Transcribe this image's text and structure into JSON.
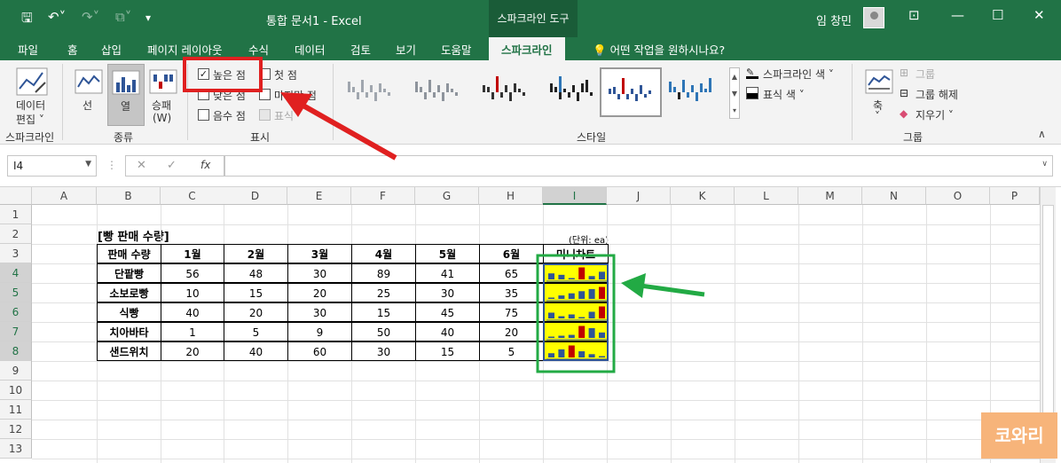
{
  "window": {
    "doc_title": "통합 문서1  -  Excel",
    "context_tab_header": "스파크라인 도구",
    "user_name": "임 창민"
  },
  "tabs": [
    "파일",
    "홈",
    "삽입",
    "페이지 레이아웃",
    "수식",
    "데이터",
    "검토",
    "보기",
    "도움말",
    "스파크라인"
  ],
  "active_tab_index": 9,
  "tell_me": "어떤 작업을 원하시나요?",
  "ribbon": {
    "sparkline_group": {
      "edit_data_line1": "데이터",
      "edit_data_line2": "편집 ˅",
      "group_label": "스파크라인"
    },
    "type_group": {
      "line": "선",
      "column": "열",
      "winloss_line1": "승패",
      "winloss_line2": "(W)",
      "group_label": "종류"
    },
    "show_group": {
      "high_point": "높은 점",
      "first_point": "첫 점",
      "low_point": "낮은 점",
      "last_point": "마지막 점",
      "negative_points": "음수 점",
      "markers": "표식",
      "group_label": "표시",
      "checked": {
        "high_point": true,
        "first_point": false,
        "low_point": false,
        "last_point": false,
        "negative_points": false,
        "markers": false
      }
    },
    "style_group": {
      "group_label": "스타일"
    },
    "color_group": {
      "sparkline_color": "스파크라인 색 ˅",
      "marker_color": "표식 색 ˅"
    },
    "group_group": {
      "axis_line1": "축",
      "axis_line2": "˅",
      "group": "그룹",
      "ungroup": "그룹 해제",
      "clear": "지우기 ˅",
      "group_label": "그룹"
    }
  },
  "formula_bar": {
    "name_box": "I4",
    "cancel": "✕",
    "enter": "✓",
    "fx": "fx",
    "formula": ""
  },
  "columns": [
    "A",
    "B",
    "C",
    "D",
    "E",
    "F",
    "G",
    "H",
    "I",
    "J",
    "K",
    "L",
    "M",
    "N",
    "O",
    "P"
  ],
  "rows": [
    "1",
    "2",
    "3",
    "4",
    "5",
    "6",
    "7",
    "8",
    "9",
    "10",
    "11",
    "12",
    "13"
  ],
  "sheet": {
    "title": "[빵 판매 수량]",
    "unit": "(단위: ea)",
    "headers": [
      "판매 수량",
      "1월",
      "2월",
      "3월",
      "4월",
      "5월",
      "6월",
      "미니차트"
    ],
    "table": [
      {
        "name": "단팥빵",
        "values": [
          "56",
          "48",
          "30",
          "89",
          "41",
          "65"
        ]
      },
      {
        "name": "소보로빵",
        "values": [
          "10",
          "15",
          "20",
          "25",
          "30",
          "35"
        ]
      },
      {
        "name": "식빵",
        "values": [
          "40",
          "20",
          "30",
          "15",
          "45",
          "75"
        ]
      },
      {
        "name": "치아바타",
        "values": [
          "1",
          "5",
          "9",
          "50",
          "40",
          "20"
        ]
      },
      {
        "name": "샌드위치",
        "values": [
          "20",
          "40",
          "60",
          "30",
          "15",
          "5"
        ]
      }
    ]
  },
  "chart_data": {
    "type": "bar",
    "categories": [
      "1월",
      "2월",
      "3월",
      "4월",
      "5월",
      "6월"
    ],
    "series": [
      {
        "name": "단팥빵",
        "values": [
          56,
          48,
          30,
          89,
          41,
          65
        ]
      },
      {
        "name": "소보로빵",
        "values": [
          10,
          15,
          20,
          25,
          30,
          35
        ]
      },
      {
        "name": "식빵",
        "values": [
          40,
          20,
          30,
          15,
          45,
          75
        ]
      },
      {
        "name": "치아바타",
        "values": [
          1,
          5,
          9,
          50,
          40,
          20
        ]
      },
      {
        "name": "샌드위치",
        "values": [
          20,
          40,
          60,
          30,
          15,
          5
        ]
      }
    ],
    "bar_color": "#2f5597",
    "high_point_color": "#c00000",
    "background_color": "#ffff00"
  },
  "watermark": "코와리",
  "colors": {
    "excel_green": "#217346",
    "red_annotation": "#e02020",
    "green_annotation": "#22aa44"
  }
}
